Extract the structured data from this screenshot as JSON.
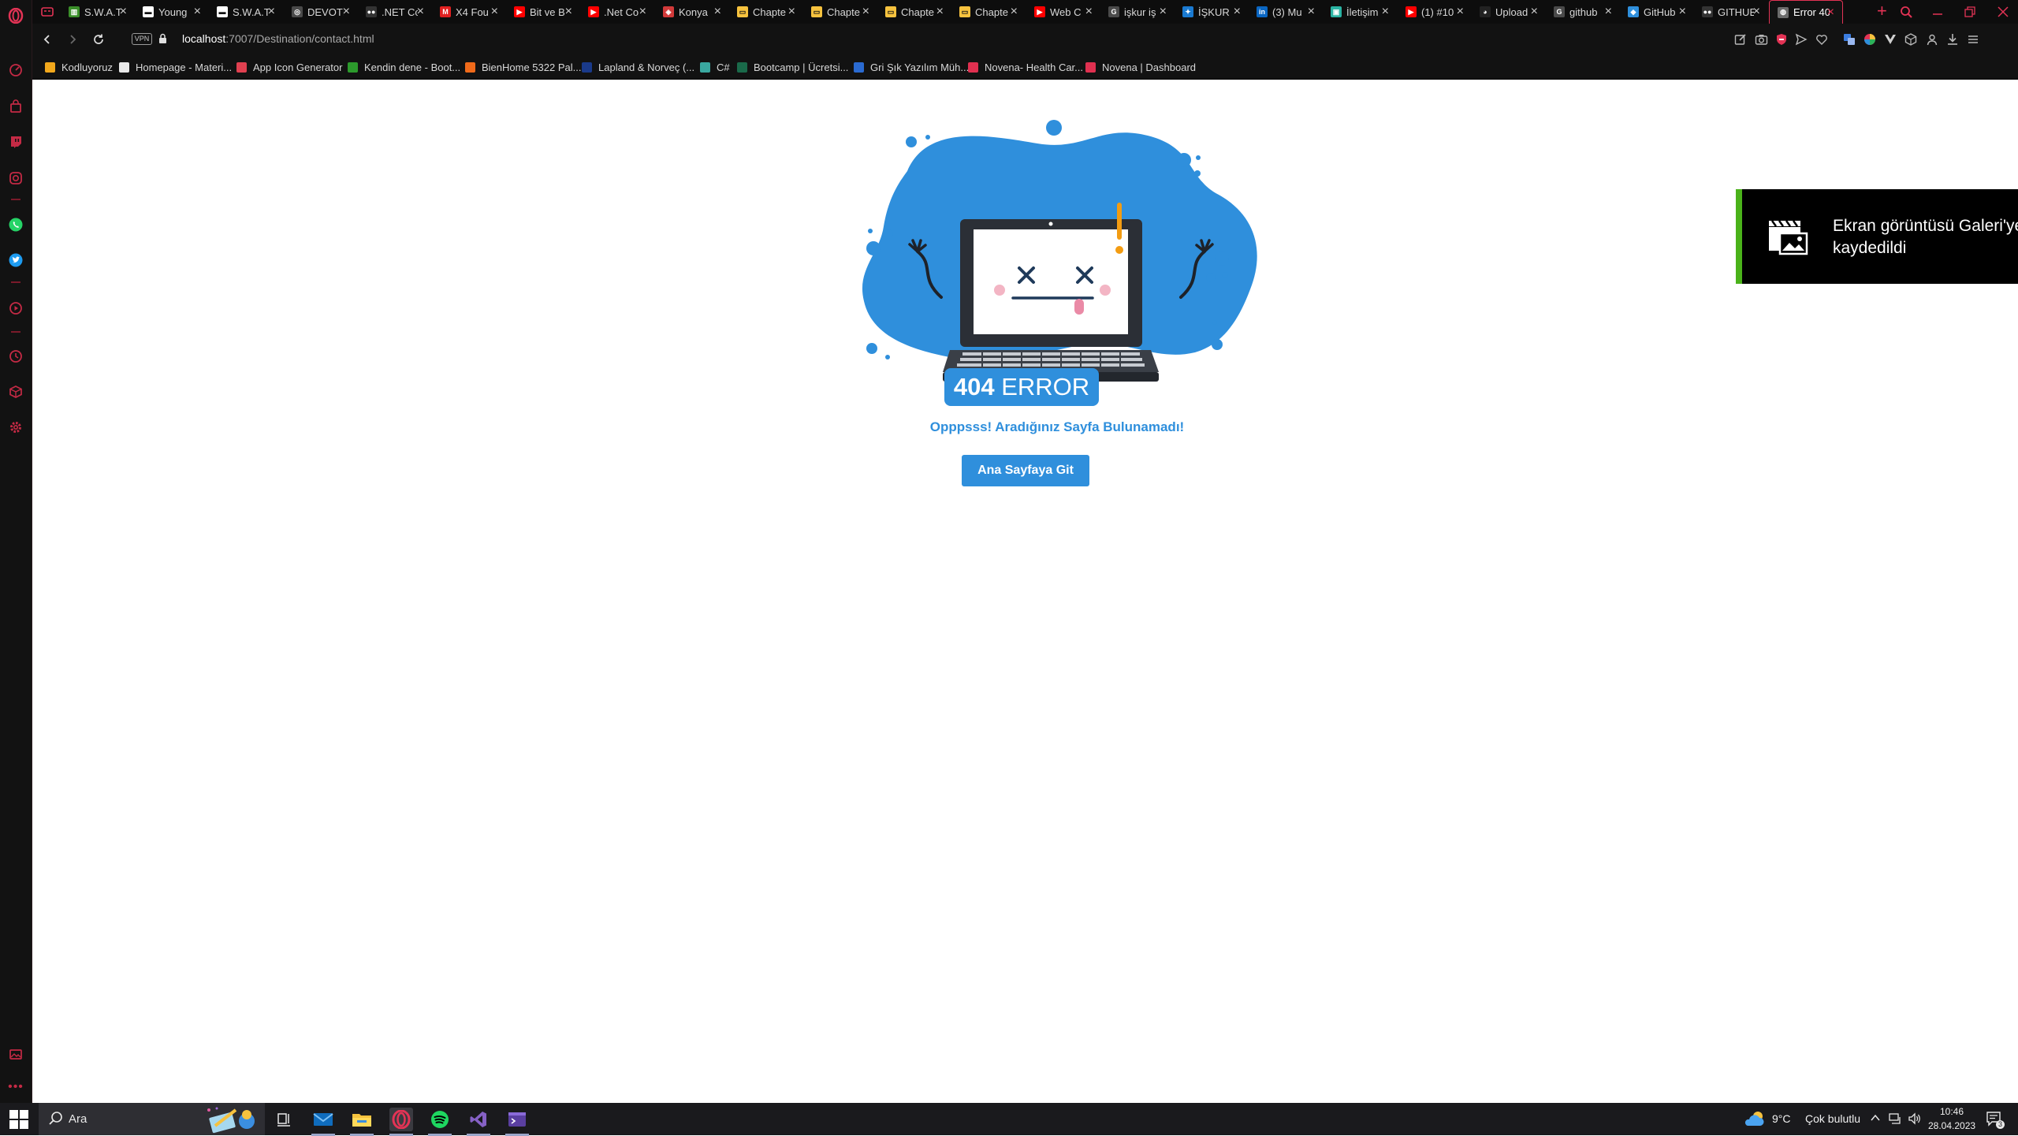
{
  "browser": {
    "tabs": [
      {
        "title": "S.W.A.T",
        "fav_color": "#3b8f2a",
        "fav_glyph": "▥"
      },
      {
        "title": "Young",
        "fav_color": "#ffffff",
        "fav_glyph": "▬"
      },
      {
        "title": "S.W.A.T",
        "fav_color": "#ffffff",
        "fav_glyph": "▬"
      },
      {
        "title": "DEVOTI",
        "fav_color": "#4a4a4a",
        "fav_glyph": "◎"
      },
      {
        "title": ".NET Co",
        "fav_color": "#333333",
        "fav_glyph": "●●"
      },
      {
        "title": "X4 Fou",
        "fav_color": "#e02020",
        "fav_glyph": "M"
      },
      {
        "title": "Bit ve B",
        "fav_color": "#ff0000",
        "fav_glyph": "▶"
      },
      {
        "title": ".Net Co",
        "fav_color": "#ff0000",
        "fav_glyph": "▶"
      },
      {
        "title": "Konya",
        "fav_color": "#d23a3a",
        "fav_glyph": "◈"
      },
      {
        "title": "Chapte",
        "fav_color": "#f6c23e",
        "fav_glyph": "▭"
      },
      {
        "title": "Chapte",
        "fav_color": "#f6c23e",
        "fav_glyph": "▭"
      },
      {
        "title": "Chapte",
        "fav_color": "#f6c23e",
        "fav_glyph": "▭"
      },
      {
        "title": "Chapte",
        "fav_color": "#f6c23e",
        "fav_glyph": "▭"
      },
      {
        "title": "Web C",
        "fav_color": "#ff0000",
        "fav_glyph": "▶"
      },
      {
        "title": "işkur iş",
        "fav_color": "#4a4a4a",
        "fav_glyph": "G"
      },
      {
        "title": "İŞKUR",
        "fav_color": "#1a7ad1",
        "fav_glyph": "✦"
      },
      {
        "title": "(3) Mu",
        "fav_color": "#0a66c2",
        "fav_glyph": "in"
      },
      {
        "title": "İletişim",
        "fav_color": "#2bb3a3",
        "fav_glyph": "▣"
      },
      {
        "title": "(1) #10",
        "fav_color": "#ff0000",
        "fav_glyph": "▶"
      },
      {
        "title": "Upload",
        "fav_color": "#222222",
        "fav_glyph": "◕"
      },
      {
        "title": "github",
        "fav_color": "#4a4a4a",
        "fav_glyph": "G"
      },
      {
        "title": "GitHub",
        "fav_color": "#2f8fdc",
        "fav_glyph": "◆"
      },
      {
        "title": "GITHUB",
        "fav_color": "#333333",
        "fav_glyph": "●●"
      },
      {
        "title": "Error 40",
        "fav_color": "#6b6b6b",
        "fav_glyph": "◍",
        "active": true
      }
    ],
    "url_host": "localhost",
    "url_path": ":7007/Destination/contact.html",
    "vpn_label": "VPN",
    "bookmarks": [
      {
        "label": "Kodluyoruz",
        "color": "#f2a81c"
      },
      {
        "label": "Homepage - Materi...",
        "color": "#e8e8e8"
      },
      {
        "label": "App Icon Generator",
        "color": "#e04050"
      },
      {
        "label": "Kendin dene - Boot...",
        "color": "#2c9a2c"
      },
      {
        "label": "BienHome 5322 Pal...",
        "color": "#f06a1a"
      },
      {
        "label": "Lapland & Norveç (...",
        "color": "#1a3a8a"
      },
      {
        "label": "C#",
        "color": "#3aa8a0"
      },
      {
        "label": "Bootcamp | Ücretsi...",
        "color": "#1a6a4a"
      },
      {
        "label": "Gri Şık Yazılım Müh...",
        "color": "#2a6ad1"
      },
      {
        "label": "Novena- Health Car...",
        "color": "#e03050"
      },
      {
        "label": "Novena | Dashboard",
        "color": "#e03050"
      }
    ]
  },
  "page": {
    "error_code": "404",
    "error_word": "ERROR",
    "message": "Opppsss! Aradığınız Sayfa Bulunamadı!",
    "home_button": "Ana Sayfaya Git"
  },
  "notification": {
    "text": "Ekran görüntüsü Galeri'ye kaydedildi"
  },
  "taskbar": {
    "search_placeholder": "Ara",
    "weather_temp": "9°C",
    "weather_text": "Çok bulutlu",
    "time": "10:46",
    "date": "28.04.2023",
    "notif_count": "3"
  },
  "colors": {
    "accent": "#2f8fdc",
    "opera_red": "#e33355",
    "toast_border": "#4ab21a"
  }
}
